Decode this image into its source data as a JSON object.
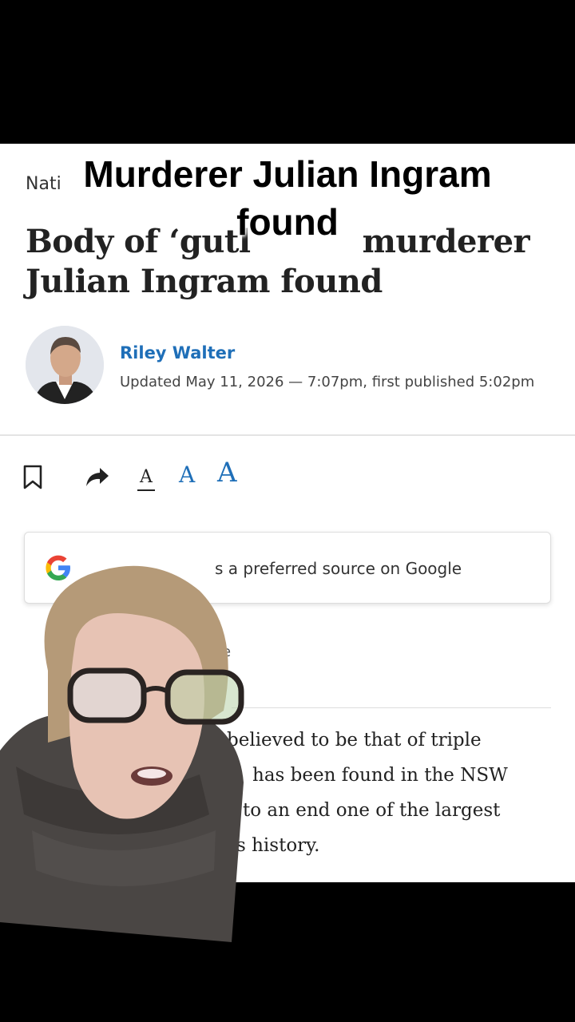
{
  "caption": {
    "line1": "Murderer Julian Ingram",
    "line2": "found"
  },
  "article": {
    "section": "Nati",
    "headline_line1": "Body of ‘gutl",
    "headline_line1_end": "murderer",
    "headline_line2": "Julian Ingram found",
    "author": {
      "name": "Riley Walter",
      "updated": "Updated May 11, 2026 — 7:07pm, first published 5:02pm"
    },
    "toolbar": {
      "bookmark_icon": "bookmark-icon",
      "share_icon": "share-icon",
      "font_small": "A",
      "font_medium": "A",
      "font_large": "A"
    },
    "google_banner": {
      "text": "s a preferred source on Google",
      "icon": "google-g-icon"
    },
    "partial_label": "e",
    "body_lines": [
      "believed to be that of triple",
      "has been found in the NSW",
      "to an end one of the largest",
      "s history."
    ]
  },
  "colors": {
    "accent": "#1f6fb8",
    "text": "#222222"
  }
}
